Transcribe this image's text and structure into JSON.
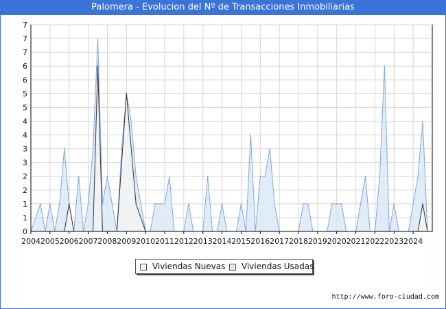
{
  "chart_data": {
    "type": "area",
    "title": "Palomera - Evolucion del Nº de Transacciones Inmobiliarias",
    "xlabel": "",
    "ylabel": "",
    "xlim": [
      2004,
      2025
    ],
    "ylim": [
      0,
      7.5
    ],
    "x_ticks": [
      "2004",
      "2005",
      "2006",
      "2007",
      "2008",
      "2009",
      "2010",
      "2011",
      "2012",
      "2013",
      "2014",
      "2015",
      "2016",
      "2017",
      "2018",
      "2019",
      "2020",
      "2021",
      "2022",
      "2023",
      "2024"
    ],
    "y_ticks": [
      {
        "v": 0,
        "label": "0"
      },
      {
        "v": 0.5,
        "label": "1"
      },
      {
        "v": 1,
        "label": "1"
      },
      {
        "v": 1.5,
        "label": "2"
      },
      {
        "v": 2,
        "label": "2"
      },
      {
        "v": 2.5,
        "label": "3"
      },
      {
        "v": 3,
        "label": "3"
      },
      {
        "v": 3.5,
        "label": "4"
      },
      {
        "v": 4,
        "label": "4"
      },
      {
        "v": 4.5,
        "label": "5"
      },
      {
        "v": 5,
        "label": "5"
      },
      {
        "v": 5.5,
        "label": "6"
      },
      {
        "v": 6,
        "label": "6"
      },
      {
        "v": 6.5,
        "label": "7"
      },
      {
        "v": 7,
        "label": "7"
      },
      {
        "v": 7.5,
        "label": "7"
      }
    ],
    "grid": true,
    "legend_position": "bottom-center",
    "series": [
      {
        "name": "Viviendas Usadas",
        "fill": "#dce9f8",
        "stroke": "#7fa8dc",
        "x": [
          2004,
          2004.5,
          2004.75,
          2005,
          2005.25,
          2005.5,
          2005.75,
          2006,
          2006.25,
          2006.5,
          2006.75,
          2007,
          2007.25,
          2007.5,
          2007.75,
          2008,
          2008.25,
          2008.5,
          2008.75,
          2009,
          2009.25,
          2009.5,
          2009.75,
          2010,
          2010.25,
          2010.5,
          2010.75,
          2011,
          2011.25,
          2011.5,
          2011.75,
          2012,
          2012.25,
          2012.5,
          2012.75,
          2013,
          2013.25,
          2013.5,
          2013.75,
          2014,
          2014.25,
          2014.5,
          2014.75,
          2015,
          2015.25,
          2015.5,
          2015.75,
          2016,
          2016.25,
          2016.5,
          2016.75,
          2017,
          2017.25,
          2017.5,
          2017.75,
          2018,
          2018.25,
          2018.5,
          2018.75,
          2019,
          2019.25,
          2019.5,
          2019.75,
          2020,
          2020.25,
          2020.5,
          2020.75,
          2021,
          2021.25,
          2021.5,
          2021.75,
          2022,
          2022.25,
          2022.5,
          2022.75,
          2023,
          2023.25,
          2023.5,
          2023.75,
          2024,
          2024.25,
          2024.5,
          2024.75
        ],
        "values": [
          0,
          1,
          0,
          1,
          0,
          1,
          3,
          1,
          0,
          2,
          0,
          1,
          3,
          7,
          1,
          2,
          1,
          0,
          3,
          5,
          4,
          2,
          1,
          0,
          0,
          1,
          1,
          1,
          2,
          0,
          0,
          0,
          1,
          0,
          0,
          0,
          2,
          0,
          0,
          1,
          0,
          0,
          0,
          1,
          0,
          3.5,
          0,
          2,
          2,
          3,
          1,
          0,
          0,
          0,
          0,
          0,
          1,
          1,
          0,
          0,
          0,
          0,
          1,
          1,
          1,
          0,
          0,
          0,
          1,
          2,
          0,
          0,
          2,
          6,
          0,
          1,
          0,
          0,
          0,
          1,
          2,
          4,
          0
        ]
      },
      {
        "name": "Viviendas Nuevas",
        "fill": "#f3f3f3",
        "stroke": "#333333",
        "x": [
          2004,
          2005.75,
          2006,
          2006.25,
          2007.25,
          2007.5,
          2007.75,
          2008.5,
          2009,
          2009.5,
          2010,
          2024.25,
          2024.5,
          2024.75
        ],
        "values": [
          0,
          0,
          1,
          0,
          0,
          6,
          0,
          0,
          5,
          1,
          0,
          0,
          1,
          0
        ]
      }
    ]
  },
  "footer": "http://www.foro-ciudad.com"
}
